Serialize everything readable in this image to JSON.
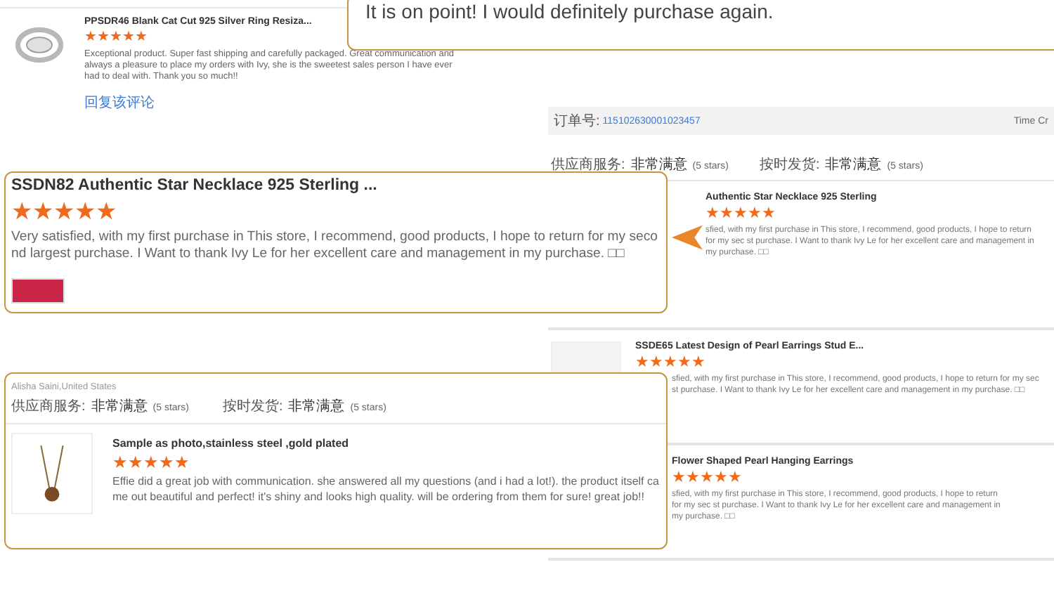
{
  "top_review": {
    "title": "PPSDR46 Blank Cat Cut 925 Silver Ring Resiza...",
    "stars": 5,
    "text": "Exceptional product. Super fast shipping and carefully packaged. Great communication and always a pleasure to place my orders with Ivy, she is the sweetest sales person I have ever had to deal with. Thank you so much!!",
    "link": "回复该评论"
  },
  "quote_box": {
    "text": "It is on point! I would definitely purchase again."
  },
  "order_panel": {
    "order_label": "订单号:",
    "order_number": "115102630001023457",
    "time_label": "Time Cr",
    "ratings": [
      {
        "label": "供应商服务:",
        "value": "非常满意",
        "note": "(5 stars)"
      },
      {
        "label": "按时发货:",
        "value": "非常满意",
        "note": "(5 stars)"
      }
    ],
    "reviews": [
      {
        "kind": "plain",
        "title": "Authentic Star Necklace 925 Sterling",
        "stars": 5,
        "text": "sfied, with my first purchase in This store, I recommend, good products, I hope to return for my sec st purchase. I Want to thank Ivy Le for her excellent care and management in my purchase. □□"
      },
      {
        "kind": "with_image",
        "title": "SSDE65 Latest Design of Pearl Earrings Stud E...",
        "stars": 5,
        "text": "sfied, with my first purchase in This store, I recommend, good products, I hope to return for my sec st purchase. I Want to thank Ivy Le for her excellent care and management in my purchase. □□"
      },
      {
        "kind": "plain",
        "title": "Flower Shaped Pearl Hanging Earrings",
        "stars": 5,
        "text": "sfied, with my first purchase in This store, I recommend, good products, I hope to return for my sec st purchase. I Want to thank Ivy Le for her excellent care and management in my purchase. □□"
      }
    ]
  },
  "callouts": [
    {
      "kind": "product",
      "title": "SSDN82 Authentic Star Necklace 925 Sterling ...",
      "stars": 5,
      "text": "Very satisfied, with my first purchase in This store, I recommend, good products, I hope to return for my second largest purchase. I Want to thank Ivy Le for her excellent care and management in my purchase.  □□"
    },
    {
      "kind": "buyer",
      "buyer": "Alisha Saini,United States",
      "ratings": [
        {
          "label": "供应商服务:",
          "value": "非常满意",
          "note": "(5 stars)"
        },
        {
          "label": "按时发货:",
          "value": "非常满意",
          "note": "(5 stars)"
        }
      ],
      "title": "Sample as photo,stainless steel ,gold plated",
      "stars": 5,
      "text": "Effie did a great job with communication. she answered all my questions (and i had a lot!). the product itself came out beautiful and perfect! it's shiny and looks high quality. will be ordering from them for sure! great job!!"
    }
  ]
}
